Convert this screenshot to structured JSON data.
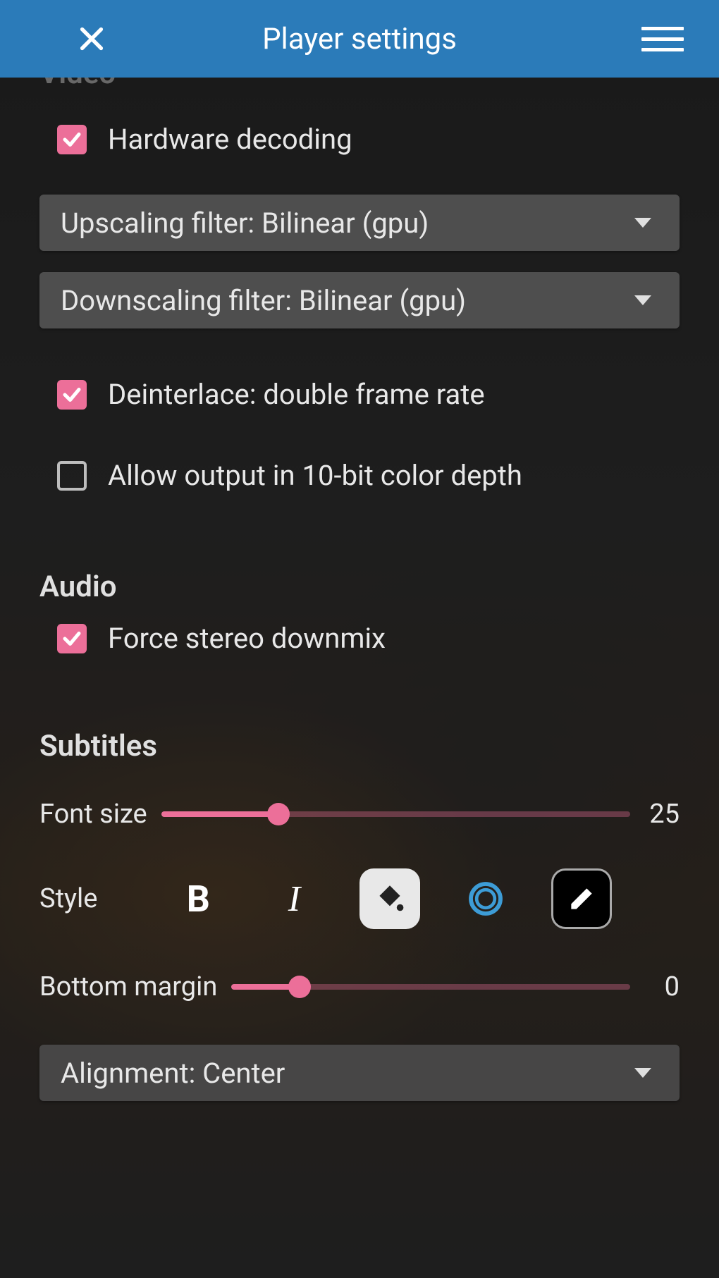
{
  "header": {
    "title": "Player settings"
  },
  "video": {
    "heading": "Video",
    "hardware_decoding": {
      "label": "Hardware decoding",
      "checked": true
    },
    "upscaling_label": "Upscaling filter: Bilinear (gpu)",
    "downscaling_label": "Downscaling filter: Bilinear (gpu)",
    "deinterlace": {
      "label": "Deinterlace: double frame rate",
      "checked": true
    },
    "tenbit": {
      "label": "Allow output in 10-bit color depth",
      "checked": false
    }
  },
  "audio": {
    "heading": "Audio",
    "force_stereo": {
      "label": "Force stereo downmix",
      "checked": true
    }
  },
  "subtitles": {
    "heading": "Subtitles",
    "font_size_label": "Font size",
    "font_size_value": "25",
    "font_size_fill_pct": 25,
    "style_label": "Style",
    "bottom_margin_label": "Bottom margin",
    "bottom_margin_value": "0",
    "bottom_margin_fill_pct": 17,
    "alignment_label": "Alignment: Center"
  },
  "colors": {
    "accent_pink": "#ec6f99",
    "header_blue": "#2b7bb9",
    "outline_blue": "#3d9cd6"
  }
}
